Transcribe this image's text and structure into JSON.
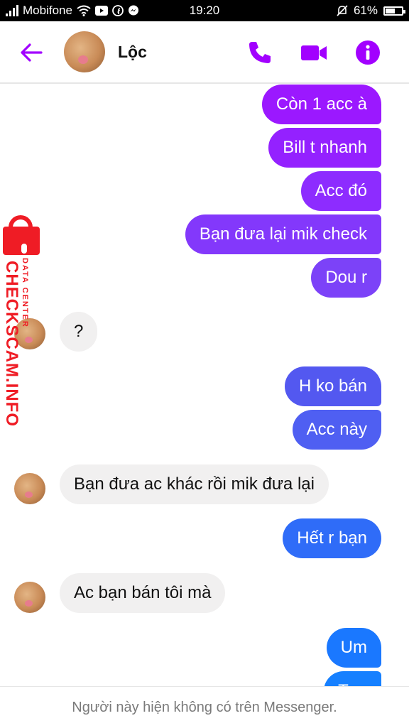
{
  "status_bar": {
    "carrier": "Mobifone",
    "time": "19:20",
    "battery": "61%",
    "battery_level": 0.61,
    "icons": [
      "signal-icon",
      "wifi-icon",
      "youtube-icon",
      "facebook-icon",
      "messenger-icon",
      "mute-icon",
      "battery-icon"
    ]
  },
  "header": {
    "contact_name": "Lộc",
    "accent_color": "#a200ff",
    "icons": [
      "back-arrow-icon",
      "phone-icon",
      "video-camera-icon",
      "info-icon"
    ]
  },
  "messages": [
    {
      "dir": "sent",
      "text": "Còn 1 acc à",
      "color": "#9b18ff"
    },
    {
      "dir": "sent",
      "text": "Bill t nhanh",
      "color": "#9421ff"
    },
    {
      "dir": "sent",
      "text": "Acc đó",
      "color": "#8d2cff"
    },
    {
      "dir": "sent",
      "text": "Bạn đưa lại mik check",
      "color": "#8338fb"
    },
    {
      "dir": "sent",
      "text": "Dou r",
      "color": "#7c42f8"
    },
    {
      "dir": "received",
      "text": "?"
    },
    {
      "dir": "sent",
      "text": "H ko bán",
      "color": "#5358f0"
    },
    {
      "dir": "sent",
      "text": "Acc này",
      "color": "#4f5ff2"
    },
    {
      "dir": "received",
      "text": "Bạn đưa ac khác rồi mik đưa lại"
    },
    {
      "dir": "sent",
      "text": "Hết r bạn",
      "color": "#2f6cf8"
    },
    {
      "dir": "received",
      "text": "Ac bạn bán tôi mà"
    },
    {
      "dir": "sent",
      "text": "Um",
      "color": "#1a78ff"
    },
    {
      "dir": "sent",
      "text": "T ...",
      "color": "#1680ff"
    }
  ],
  "watermark": {
    "big_text": "CHECKSCAM.INFO",
    "small_text": "DATA CENTER",
    "color": "#ef1c25"
  },
  "footer": {
    "notice": "Người này hiện không có trên Messenger."
  }
}
